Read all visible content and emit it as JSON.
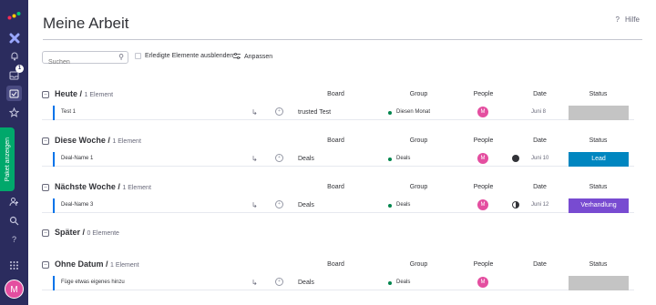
{
  "header": {
    "title": "Meine Arbeit",
    "help_label": "Hilfe",
    "help_icon": "?"
  },
  "toolbar": {
    "search_placeholder": "Suchen",
    "hide_done_label": "Erledigte Elemente ausblenden",
    "customize_label": "Anpassen"
  },
  "sidebar": {
    "notifications_count": "1",
    "panel_label": "Paket anzeigen",
    "avatar_initial": "M"
  },
  "columns": {
    "board": "Board",
    "group": "Group",
    "people": "People",
    "date": "Date",
    "status": "Status"
  },
  "groups": [
    {
      "title": "Heute",
      "count": "1 Element",
      "rows": [
        {
          "name": "Test 1",
          "board": "trusted Test",
          "group": "Diesen Monat",
          "person": "M",
          "date": "Juni 8",
          "status": "",
          "status_color": "#c4c4c4",
          "progress": ""
        }
      ]
    },
    {
      "title": "Diese Woche",
      "count": "1 Element",
      "rows": [
        {
          "name": "Deal-Name 1",
          "board": "Deals",
          "group": "Deals",
          "person": "M",
          "date": "Juni 10",
          "status": "Lead",
          "status_color": "#0086c0",
          "progress": "full"
        }
      ]
    },
    {
      "title": "Nächste Woche",
      "count": "1 Element",
      "rows": [
        {
          "name": "Deal-Name 3",
          "board": "Deals",
          "group": "Deals",
          "person": "M",
          "date": "Juni 12",
          "status": "Verhandlung",
          "status_color": "#784bd1",
          "progress": "half"
        }
      ]
    },
    {
      "title": "Später",
      "count": "0 Elemente",
      "rows": []
    },
    {
      "title": "Ohne Datum",
      "count": "1 Element",
      "rows": [
        {
          "name": "Füge etwas eigenes hinzu",
          "board": "Deals",
          "group": "Deals",
          "person": "M",
          "date": "",
          "status": "",
          "status_color": "#c4c4c4",
          "progress": ""
        }
      ]
    }
  ],
  "colors": {
    "rail": "#2b2c5e",
    "accent": "#0073ea",
    "green": "#00a86b",
    "avatar": "#e44ea0"
  }
}
